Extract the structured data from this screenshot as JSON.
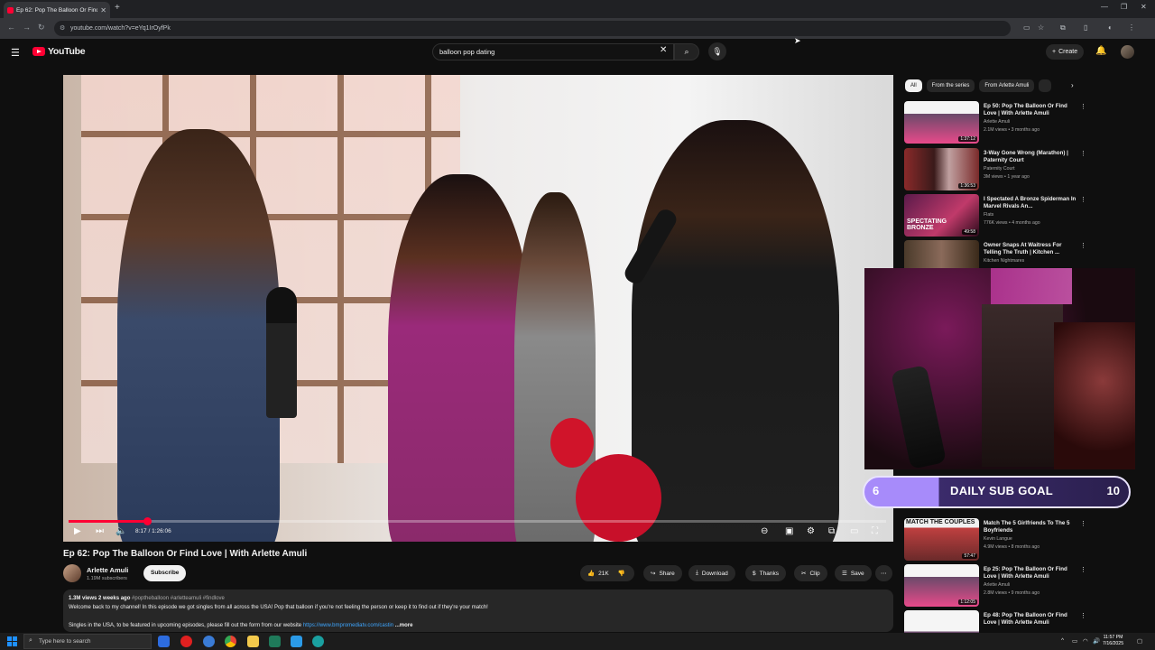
{
  "browser": {
    "tab_title": "Ep 62: Pop The Balloon Or Find",
    "url": "youtube.com/watch?v=eYq1IrOyfPk"
  },
  "youtube": {
    "logo_text": "YouTube",
    "search_value": "balloon pop dating",
    "create_label": "Create"
  },
  "video": {
    "time": "8:17 / 1:26:06",
    "progress_fraction": 0.096,
    "title": "Ep 62: Pop The Balloon Or Find Love | With Arlette Amuli",
    "channel": "Arlette Amuli",
    "subscribers": "1.19M subscribers",
    "subscribe_label": "Subscribe",
    "likes": "21K",
    "share_label": "Share",
    "download_label": "Download",
    "thanks_label": "Thanks",
    "clip_label": "Clip",
    "save_label": "Save"
  },
  "description": {
    "meta": "1.3M views  2 weeks ago",
    "tags": "#poptheballoon #arletteamuli #findlove",
    "line1": "Welcome back to my channel! In this episode we got singles from all across the USA! Pop that balloon if you're not feeling the person or keep it to find out if they're your match!",
    "line2_prefix": "Singles in the USA, to be featured in upcoming episodes, please fill out the form from our website ",
    "line2_link": "https://www.bmpromediatv.com/castin",
    "more_label": "...more"
  },
  "chips": [
    "All",
    "From the series",
    "From Arlette Amuli"
  ],
  "recommendations": [
    {
      "title": "Ep 50: Pop The Balloon Or Find Love | With Arlette Amuli",
      "channel": "Arlette Amuli",
      "views": "2.1M views • 3 months ago",
      "duration": "1:37:12",
      "color": "#6a4a6a"
    },
    {
      "title": "3-Way Gone Wrong (Marathon) | Paternity Court",
      "channel": "Paternity Court",
      "views": "3M views • 1 year ago",
      "duration": "1:36:53",
      "color": "#8a2a2a"
    },
    {
      "title": "I Spectated A Bronze Spiderman In Marvel Rivals An...",
      "channel": "Flats",
      "views": "776K views • 4 months ago",
      "duration": "49:58",
      "color": "#9a3a6a"
    },
    {
      "title": "Owner Snaps At Waitress For Telling The Truth | Kitchen ...",
      "channel": "Kitchen Nightmares",
      "views": "",
      "duration": "",
      "color": "#5a4a3a"
    },
    {
      "title": "Match The 5 Girlfriends To The 5 Boyfriends",
      "channel": "Kevin Langue",
      "views": "4.9M views • 8 months ago",
      "duration": "57:47",
      "color": "#a03030"
    },
    {
      "title": "Ep 25: Pop The Balloon Or Find Love | With Arlette Amuli",
      "channel": "Arlette Amuli",
      "views": "2.8M views • 9 months ago",
      "duration": "1:12:05",
      "color": "#6a4a6a"
    },
    {
      "title": "Ep 48: Pop The Balloon Or Find Love | With Arlette Amuli",
      "channel": "",
      "views": "",
      "duration": "",
      "color": "#6a4a6a"
    }
  ],
  "thumb_text": {
    "rec3": "SPECTATING BRONZE",
    "rec5": "MATCH THE COUPLES"
  },
  "sub_goal": {
    "current": "6",
    "label": "DAILY SUB GOAL",
    "target": "10",
    "progress_fraction": 0.6
  },
  "taskbar": {
    "search_placeholder": "Type here to search",
    "time": "11:57 PM",
    "date": "7/16/2025"
  }
}
